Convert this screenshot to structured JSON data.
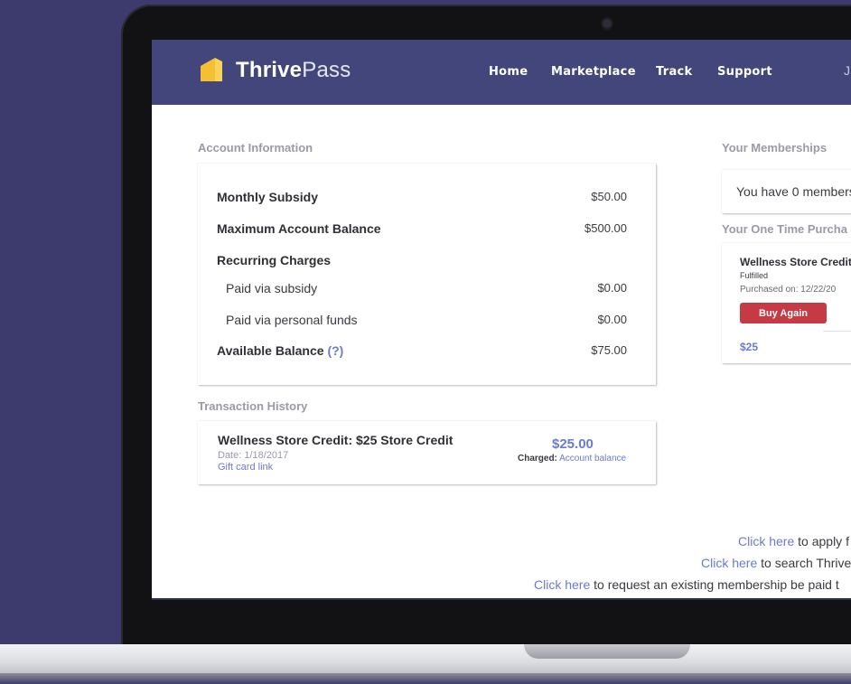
{
  "brand": {
    "name_bold": "Thrive",
    "name_light": "Pass",
    "accent_yellow": "#f4c033",
    "navbar_color": "#43467a"
  },
  "nav": {
    "items": [
      "Home",
      "Marketplace",
      "Track",
      "Support"
    ],
    "partial_item": "J"
  },
  "account": {
    "section_title": "Account Information",
    "monthly_subsidy_label": "Monthly Subsidy",
    "monthly_subsidy_value": "$50.00",
    "max_balance_label": "Maximum Account Balance",
    "max_balance_value": "$500.00",
    "recurring_label": "Recurring Charges",
    "paid_subsidy_label": "Paid via subsidy",
    "paid_subsidy_value": "$0.00",
    "paid_personal_label": "Paid via personal funds",
    "paid_personal_value": "$0.00",
    "available_label": "Available Balance",
    "available_help": "(?)",
    "available_value": "$75.00"
  },
  "transactions": {
    "section_title": "Transaction History",
    "items": [
      {
        "title": "Wellness Store Credit: $25 Store Credit",
        "date": "Date: 1/18/2017",
        "link": "Gift card link",
        "amount": "$25.00",
        "charged_label": "Charged:",
        "charged_value": "Account balance"
      }
    ]
  },
  "memberships": {
    "section_title": "Your Memberships",
    "message": "You have 0 members"
  },
  "one_time": {
    "section_title": "Your One Time Purcha",
    "item_title": "Wellness Store Credit",
    "status": "Fulfilled",
    "purchased": "Purchased on: 12/22/20",
    "button": "Buy Again",
    "price": "$25"
  },
  "footer": {
    "line1_link": "Click here",
    "line1_text": " to apply f",
    "line2_link": "Click here",
    "line2_text": " to search Thrive",
    "line3_link": "Click here",
    "line3_text": " to request an existing membership be paid t"
  }
}
